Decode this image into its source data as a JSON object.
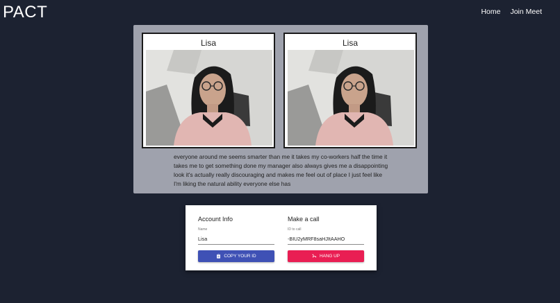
{
  "header": {
    "logo": "PACT",
    "nav": [
      {
        "label": "Home"
      },
      {
        "label": "Join Meet"
      }
    ]
  },
  "videos": [
    {
      "name": "Lisa"
    },
    {
      "name": "Lisa"
    }
  ],
  "transcript": "everyone around me seems smarter than me it takes my co-workers half the time it takes me to get something done my manager also always gives me a disappointing look it's actually really discouraging and makes me feel out of place I just feel like I'm liking the natural ability everyone else has",
  "account": {
    "title": "Account Info",
    "name_label": "Name",
    "name_value": "Lisa",
    "copy_button": "COPY YOUR ID",
    "copy_icon": "clipboard-icon"
  },
  "call": {
    "title": "Make a call",
    "id_label": "ID to call",
    "id_value": "-BIU2yMRF8saHJItAAHO",
    "hangup_button": "HANG UP",
    "hangup_icon": "phone-hangup-icon"
  },
  "colors": {
    "background": "#1c2231",
    "panel": "#9fa2ad",
    "primary_button": "#3f51b5",
    "danger_button": "#e91e53"
  }
}
